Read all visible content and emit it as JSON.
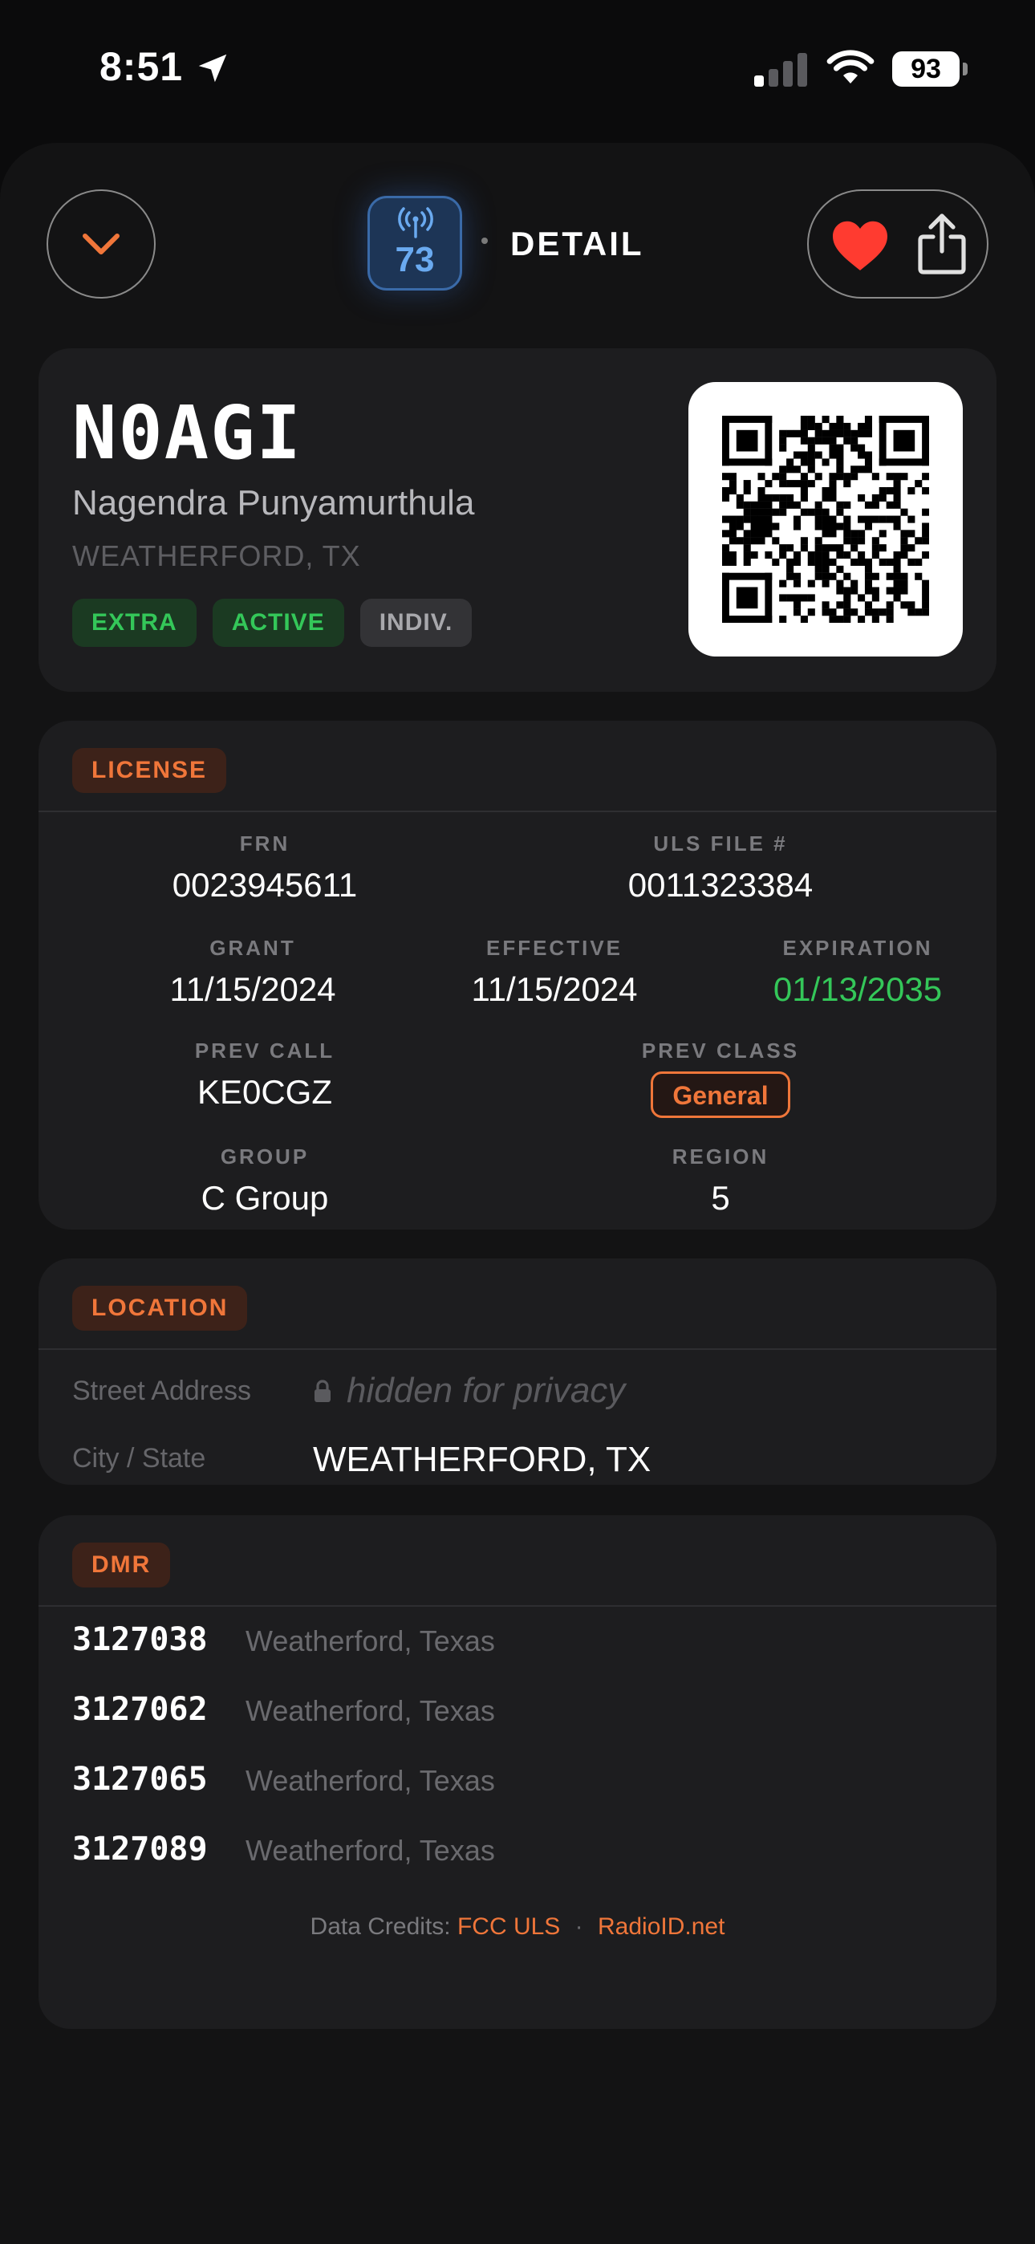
{
  "status_bar": {
    "time": "8:51",
    "battery": "93"
  },
  "header": {
    "app_icon_number": "73",
    "title": "DETAIL"
  },
  "identity": {
    "callsign": "N0AGI",
    "name": "Nagendra Punyamurthula",
    "location": "WEATHERFORD, TX",
    "badges": [
      "EXTRA",
      "ACTIVE",
      "INDIV."
    ]
  },
  "license": {
    "tag": "LICENSE",
    "frn_label": "FRN",
    "frn": "0023945611",
    "uls_label": "ULS FILE #",
    "uls": "0011323384",
    "grant_label": "GRANT",
    "grant": "11/15/2024",
    "effective_label": "EFFECTIVE",
    "effective": "11/15/2024",
    "expiration_label": "EXPIRATION",
    "expiration": "01/13/2035",
    "prev_call_label": "PREV CALL",
    "prev_call": "KE0CGZ",
    "prev_class_label": "PREV CLASS",
    "prev_class": "General",
    "group_label": "GROUP",
    "group": "C Group",
    "region_label": "REGION",
    "region": "5"
  },
  "location": {
    "tag": "LOCATION",
    "street_label": "Street Address",
    "street_value": "hidden for privacy",
    "city_label": "City / State",
    "city_value": "WEATHERFORD, TX"
  },
  "dmr": {
    "tag": "DMR",
    "entries": [
      {
        "id": "3127038",
        "place": "Weatherford, Texas"
      },
      {
        "id": "3127062",
        "place": "Weatherford, Texas"
      },
      {
        "id": "3127065",
        "place": "Weatherford, Texas"
      },
      {
        "id": "3127089",
        "place": "Weatherford, Texas"
      }
    ]
  },
  "credits": {
    "label": "Data Credits:",
    "source1": "FCC ULS",
    "source2": "RadioID.net",
    "sep": "·"
  },
  "colors": {
    "accent": "#f0763a",
    "green": "#34c759",
    "blue": "#6aaaf0",
    "background": "#0b0b0c",
    "card": "#1d1d1f"
  }
}
